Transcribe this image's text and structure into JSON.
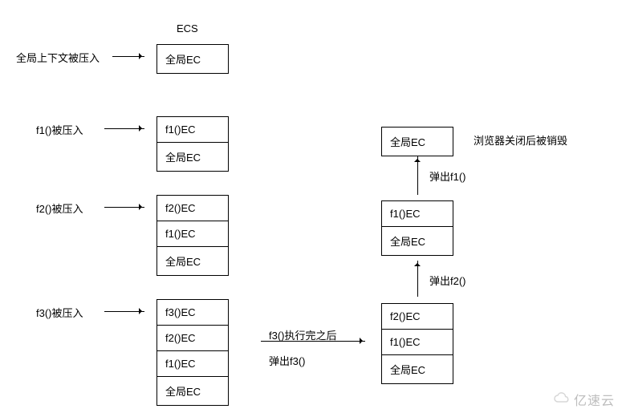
{
  "header": {
    "title": "ECS"
  },
  "labels": {
    "push_global": "全局上下文被压入",
    "push_f1": "f1()被压入",
    "push_f2": "f2()被压入",
    "push_f3": "f3()被压入",
    "after_f3_exec": "f3()执行完之后",
    "pop_f3": "弹出f3()",
    "pop_f2": "弹出f2()",
    "pop_f1": "弹出f1()",
    "browser_destroy": "浏览器关闭后被销毁"
  },
  "frames": {
    "global_ec": "全局EC",
    "f1_ec": "f1()EC",
    "f2_ec": "f2()EC",
    "f3_ec": "f3()EC"
  },
  "stacks": {
    "s1": [
      "global_ec"
    ],
    "s2": [
      "f1_ec",
      "global_ec"
    ],
    "s3": [
      "f2_ec",
      "f1_ec",
      "global_ec"
    ],
    "s4": [
      "f3_ec",
      "f2_ec",
      "f1_ec",
      "global_ec"
    ],
    "s5": [
      "f2_ec",
      "f1_ec",
      "global_ec"
    ],
    "s6": [
      "f1_ec",
      "global_ec"
    ],
    "s7": [
      "global_ec"
    ]
  },
  "watermark": "亿速云"
}
